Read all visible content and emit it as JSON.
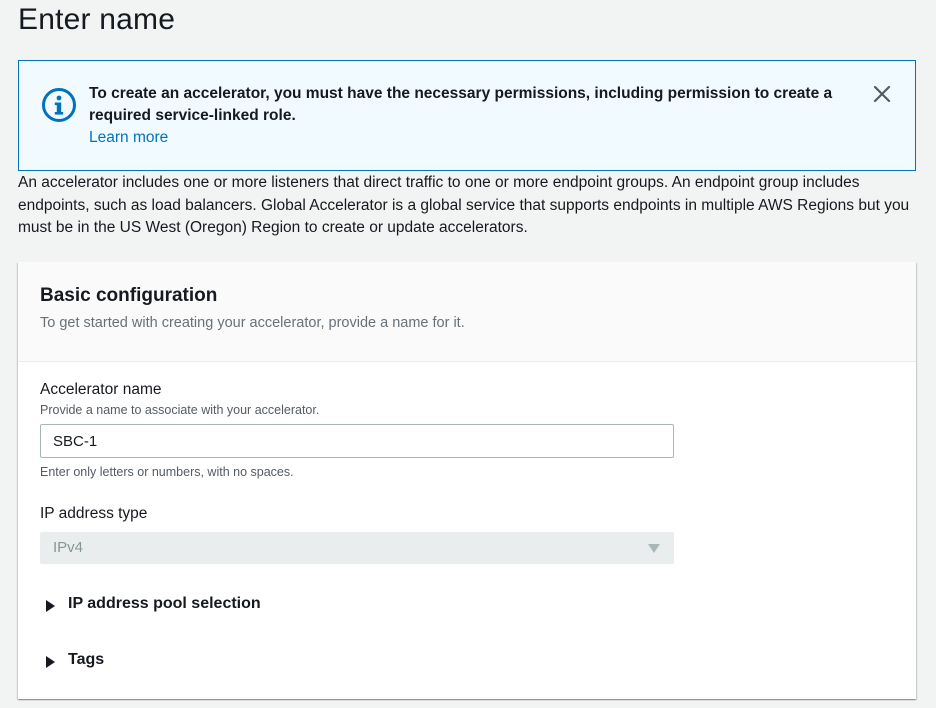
{
  "page": {
    "title": "Enter name"
  },
  "alert": {
    "message": "To create an accelerator, you must have the necessary permissions, including permission to create a required service-linked role.",
    "link": "Learn more",
    "icon": "info-icon",
    "close_icon": "close-icon",
    "accent": "#0073bb"
  },
  "intro": {
    "text": "An accelerator includes one or more listeners that direct traffic to one or more endpoint groups. An endpoint group includes endpoints, such as load balancers. Global Accelerator is a global service that supports endpoints in multiple AWS Regions but you must be in the US West (Oregon) Region to create or update accelerators."
  },
  "basic_config": {
    "title": "Basic configuration",
    "description": "To get started with creating your accelerator, provide a name for it.",
    "accelerator_name": {
      "label": "Accelerator name",
      "description": "Provide a name to associate with your accelerator.",
      "value": "SBC-1",
      "constraint": "Enter only letters or numbers, with no spaces."
    },
    "ip_address_type": {
      "label": "IP address type",
      "selected": "IPv4",
      "disabled": true
    },
    "sections": [
      {
        "label": "IP address pool selection",
        "expanded": false
      },
      {
        "label": "Tags",
        "expanded": false
      }
    ]
  }
}
